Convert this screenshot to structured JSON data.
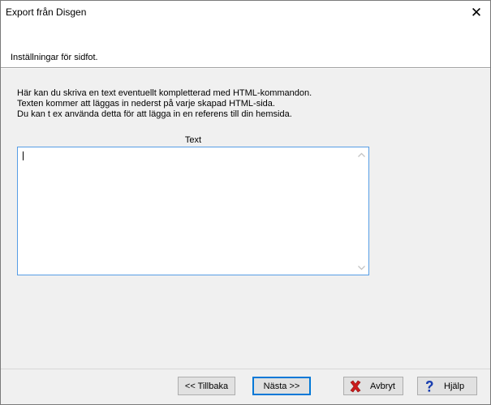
{
  "window": {
    "title": "Export från Disgen",
    "close_glyph": "✕"
  },
  "header": {
    "subtitle": "Inställningar för sidfot."
  },
  "description": {
    "line1": "Här kan du skriva en text eventuellt kompletterad med HTML-kommandon.",
    "line2": "Texten kommer att läggas in nederst på varje skapad HTML-sida.",
    "line3": "Du kan t ex använda detta för att lägga in en referens till din hemsida."
  },
  "text_field": {
    "label": "Text",
    "value": ""
  },
  "buttons": {
    "back": "<< Tillbaka",
    "next": "Nästa >>",
    "cancel": "Avbryt",
    "help": "Hjälp"
  },
  "icons": {
    "close": "close-icon",
    "cancel": "red-x-icon",
    "help": "question-mark-icon",
    "scroll_up": "chevron-up-icon",
    "scroll_down": "chevron-down-icon"
  },
  "colors": {
    "accent_border": "#0078d7",
    "textarea_border": "#569de5",
    "cancel_icon": "#cc1a1a",
    "help_icon": "#1a3fb0"
  }
}
